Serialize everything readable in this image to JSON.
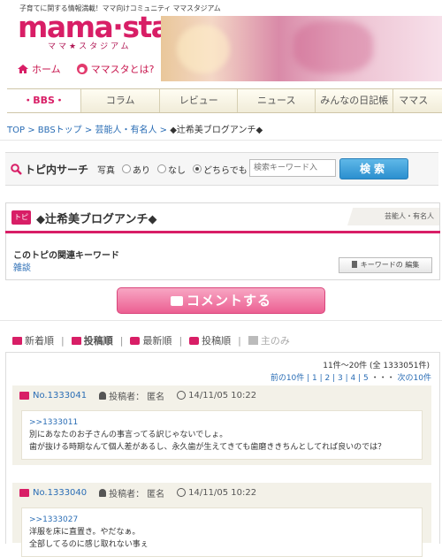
{
  "header": {
    "tagline": "子育てに関する情報満載！ママ向けコミュニティ ママスタジアム",
    "logo_main": "mama·sta",
    "logo_sub": "ママ★スタジアム",
    "nav": [
      {
        "label": "ホーム",
        "icon": "home-icon"
      },
      {
        "label": "ママスタとは?",
        "icon": "info-icon"
      }
    ]
  },
  "gnav": {
    "tabs": [
      "・BBS・",
      "コラム",
      "レビュー",
      "ニュース",
      "みんなの日記帳",
      "ママス"
    ],
    "active": 0
  },
  "breadcrumb": {
    "items": [
      "TOP",
      "BBSトップ",
      "芸能人・有名人"
    ],
    "separator": ">",
    "current": "◆辻希美ブログアンチ◆"
  },
  "search": {
    "label": "トピ内サーチ",
    "photo_label": "写真",
    "options": [
      "あり",
      "なし",
      "どちらでも"
    ],
    "selected": 2,
    "placeholder": "検索キーワード入",
    "button": "検索"
  },
  "topic": {
    "badge": "トピ",
    "title": "◆辻希美ブログアンチ◆",
    "category": "芸能人・有名人",
    "keywords_heading": "このトピの関連キーワード",
    "keyword": "雑談",
    "edit_button": "キーワードの 編集"
  },
  "comment_button": "コメントする",
  "sort": {
    "options": [
      "新着順",
      "投稿順",
      "最新順",
      "投稿順",
      "主のみ"
    ]
  },
  "list": {
    "count": "11件～20件 (全 1333051件)",
    "pager_prev": "前の10件",
    "pages": [
      "1",
      "2",
      "3",
      "4",
      "5"
    ],
    "ellipsis": "・・・",
    "pager_next": "次の10件"
  },
  "posts": [
    {
      "number": "No.1333041",
      "author_label": "投稿者：",
      "author": "匿名",
      "date": "14/11/05 10:22",
      "ref": ">>1333011",
      "lines": [
        "別にあなたのお子さんの事言ってる訳じゃないでしょ。",
        "歯が抜ける時期なんて個人差があるし、永久歯が生えてきても歯磨ききちんとしてれば良いのでは？"
      ]
    },
    {
      "number": "No.1333040",
      "author_label": "投稿者：",
      "author": "匿名",
      "date": "14/11/05 10:22",
      "ref": ">>1333027",
      "lines": [
        "洋服を床に直置き。やだなぁ。",
        "全部してるのに感じ取れない事ぇ"
      ]
    }
  ],
  "colors": {
    "brand": "#d81e66",
    "link": "#2a6db5",
    "search_button": "#2b8fcf"
  }
}
